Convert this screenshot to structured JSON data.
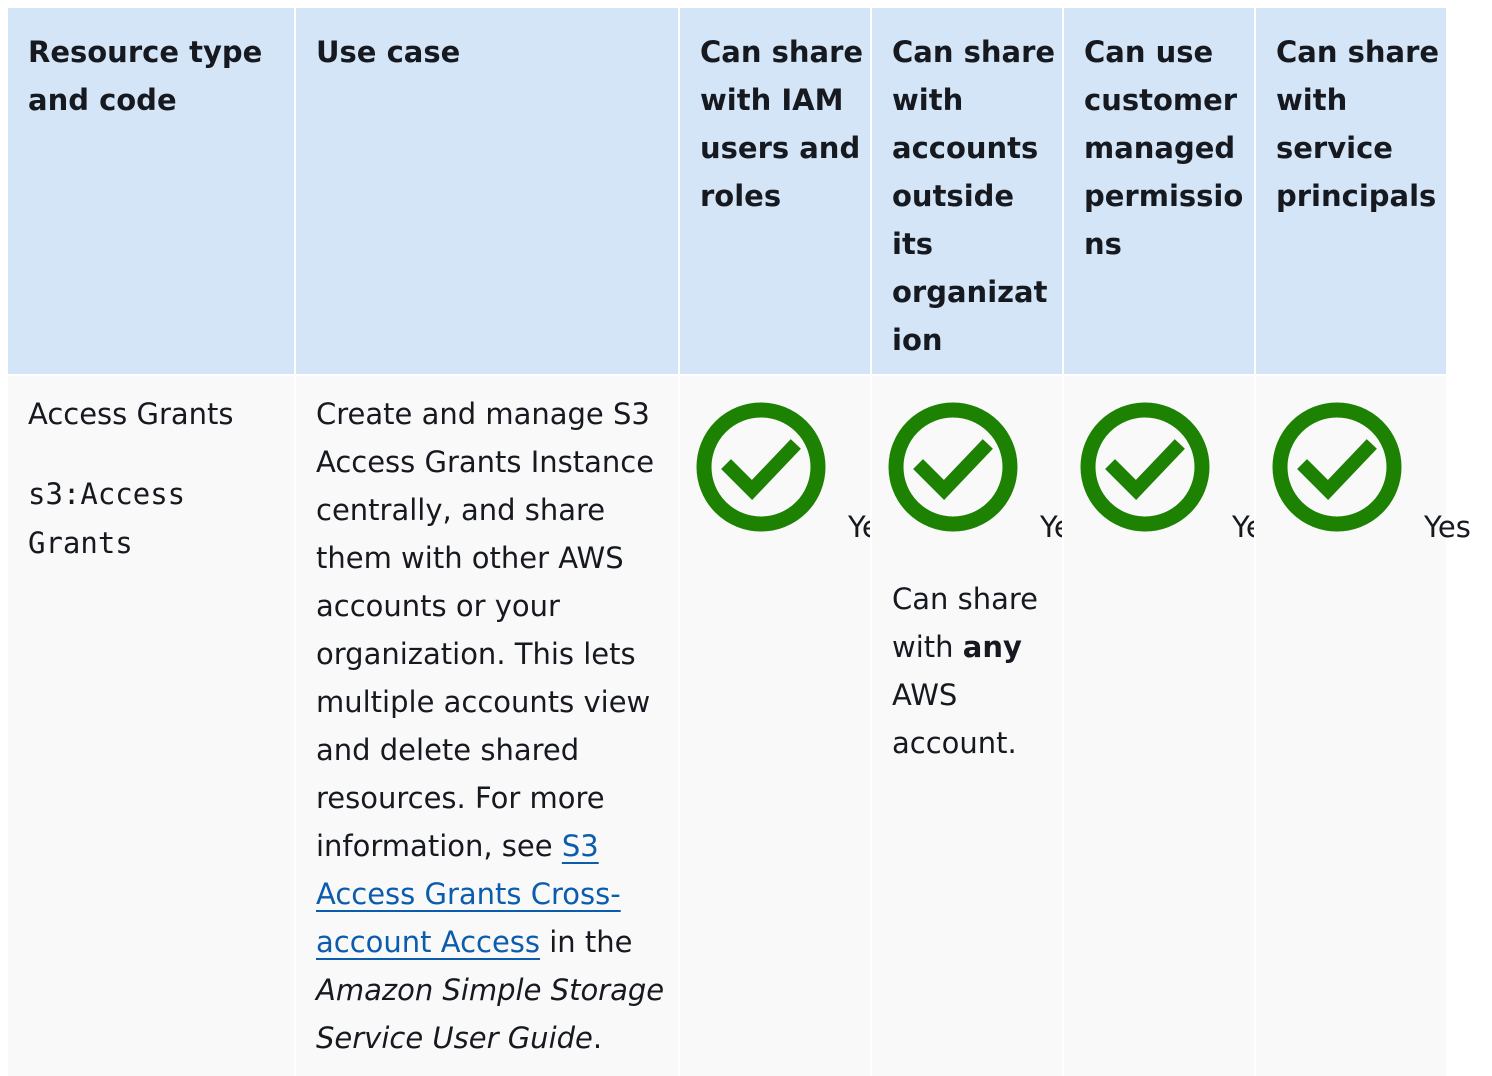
{
  "headers": [
    "Resource type\nand code",
    "Use case",
    "Can share\nwith IAM\nusers and\nroles",
    "Can share\nwith\naccounts\noutside\nits\norganizat\nion",
    "Can use\ncustomer\nmanaged\npermissio\nns",
    "Can share\nwith\nservice\nprincipals"
  ],
  "row": {
    "resource_name": "Access Grants",
    "resource_code": "s3:Access\nGrants",
    "use_case_text": "Create and manage S3 Access Grants Instance centrally, and share them with other AWS accounts or your organization. This lets multiple accounts view and delete shared resources. For more information, see ",
    "use_case_link": "S3 Access Grants Cross-account Access",
    "use_case_mid": " in the ",
    "use_case_guide": "Amazon Simple Storage Service User Guide",
    "use_case_end": ".",
    "yes_label": "Yes",
    "outside_note_prefix": "Can share with ",
    "outside_note_bold": "any",
    "outside_note_suffix": " AWS account."
  },
  "icons": {
    "check": "check-circle-icon",
    "check_color": "#1d8102"
  }
}
